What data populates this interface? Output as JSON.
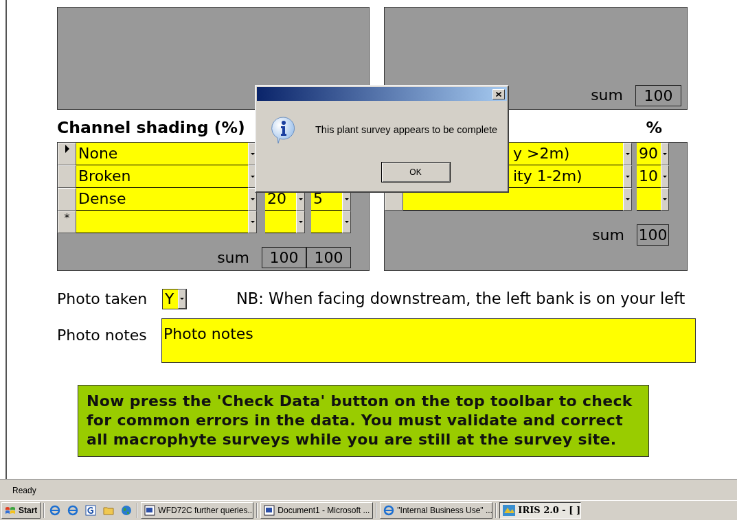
{
  "upper_right_panel": {
    "sum_label": "sum",
    "sum": "100"
  },
  "channel_shading": {
    "title": "Channel shading (%)",
    "sum_label": "sum",
    "sums": [
      "100",
      "100"
    ],
    "rows": [
      {
        "kind": "record",
        "current": true,
        "label": "None",
        "values": []
      },
      {
        "kind": "record",
        "current": false,
        "label": "Broken",
        "values": []
      },
      {
        "kind": "record",
        "current": false,
        "label": "Dense",
        "values": [
          "20",
          "5"
        ]
      },
      {
        "kind": "new",
        "current": false,
        "marker": "*",
        "values": []
      }
    ]
  },
  "right_table": {
    "title": "%",
    "sum_label": "sum",
    "sum": "100",
    "rows": [
      {
        "label": "y >2m)",
        "values": [
          "90"
        ]
      },
      {
        "label": "ity 1-2m)",
        "values": [
          "10"
        ]
      },
      {
        "values": []
      }
    ]
  },
  "photo_taken": {
    "label": "Photo taken",
    "value": "Y"
  },
  "note": "NB: When facing downstream, the left bank is on your left",
  "photo_notes": {
    "label": "Photo notes",
    "value": "Photo notes"
  },
  "instruction": "Now press the 'Check Data' button on the top toolbar to check for common errors in the data. You must validate and correct all macrophyte surveys while you are still at the survey site.",
  "dialog": {
    "message": "This plant survey appears to be complete",
    "button": "OK"
  },
  "status_bar": "Ready",
  "taskbar": {
    "start": "Start",
    "quick_launch": [
      {
        "kind": "ie"
      },
      {
        "kind": "ie"
      },
      {
        "kind": "g"
      },
      {
        "kind": "folder"
      },
      {
        "kind": "globe"
      }
    ],
    "tasks": [
      {
        "kind": "word",
        "label": "WFD72C further queries...",
        "selected": false
      },
      {
        "kind": "word",
        "label": "Document1 - Microsoft ...",
        "selected": false
      },
      {
        "kind": "ie",
        "label": "\"Internal Business Use\" ...",
        "selected": false
      },
      {
        "kind": "app",
        "label": "IRIS 2.0 - [ ]",
        "selected": true
      }
    ]
  }
}
